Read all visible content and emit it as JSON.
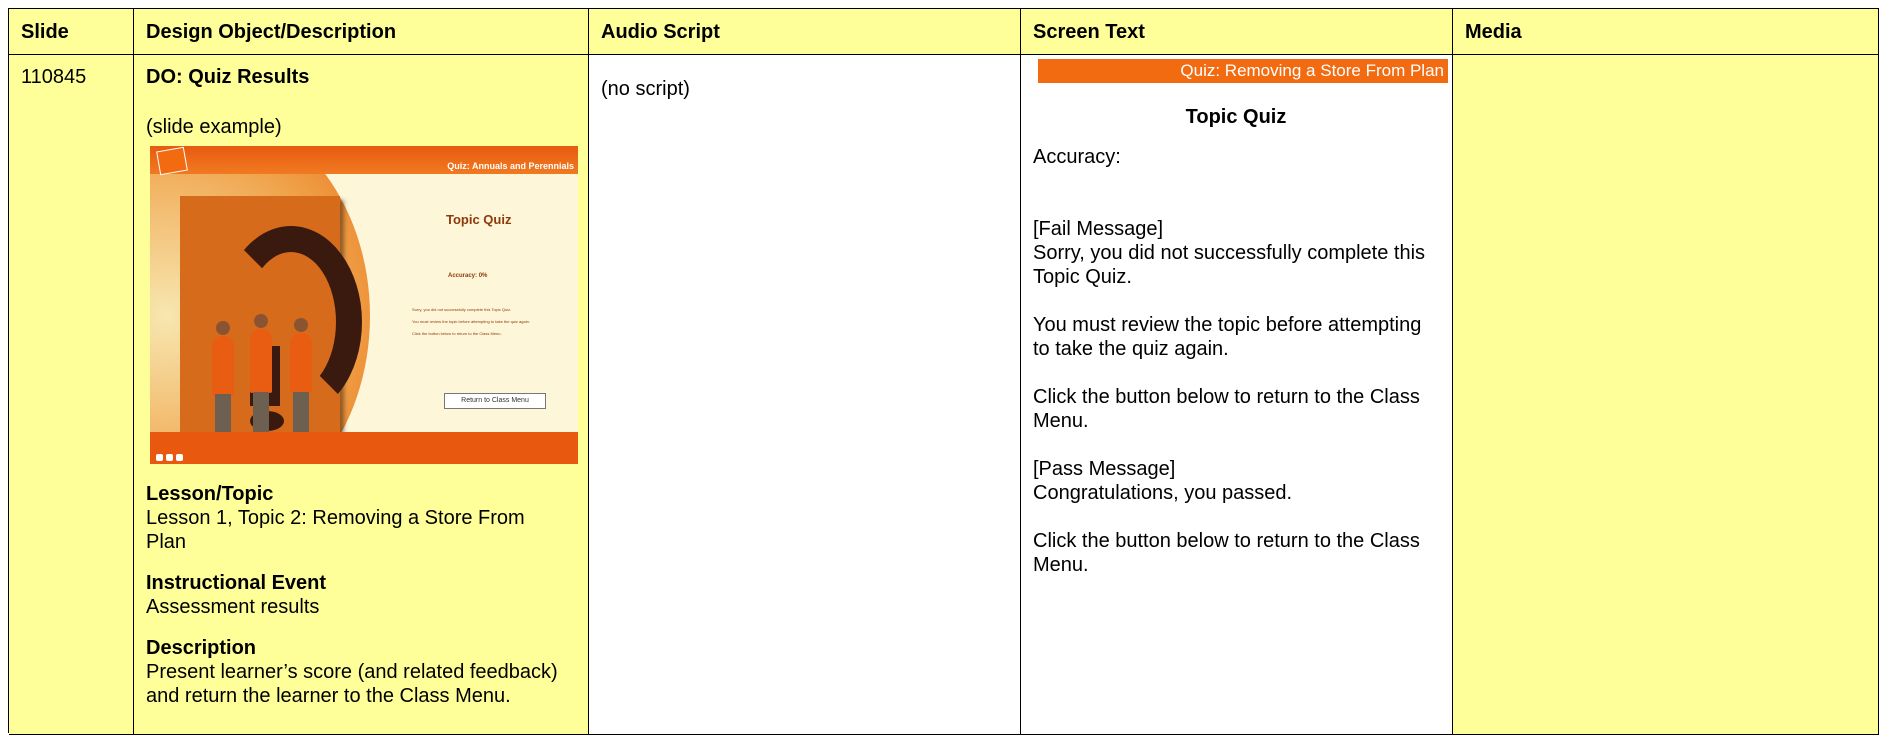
{
  "headers": {
    "slide": "Slide",
    "design": "Design Object/Description",
    "audio": "Audio Script",
    "screen": "Screen Text",
    "media": "Media"
  },
  "row": {
    "slide_number": "110845",
    "design": {
      "do_title": "DO: Quiz Results",
      "slide_example_label": "(slide example)",
      "lesson_heading": "Lesson/Topic",
      "lesson_text": "Lesson 1, Topic 2: Removing a Store From Plan",
      "event_heading": "Instructional Event",
      "event_text": "Assessment results",
      "description_heading": "Description",
      "description_text": "Present learner’s score (and related feedback) and return the learner to the Class Menu."
    },
    "thumbnail": {
      "header_title": "Quiz: Annuals and Perennials",
      "topic_quiz": "Topic Quiz",
      "accuracy": "Accuracy:",
      "accuracy_value": "0%",
      "line1": "Sorry, you did not successfully complete this Topic Quiz.",
      "line2": "You must review the topic before attempting to take the quiz again.",
      "line3": "Click the button below to return to the Class Menu.",
      "button": "Return to Class Menu"
    },
    "audio": "(no script)",
    "screen": {
      "banner": "Quiz: Removing a Store From Plan",
      "topic_quiz": "Topic Quiz",
      "accuracy": "Accuracy:",
      "fail_label": "[Fail Message]",
      "fail_text": "Sorry, you did not successfully complete this Topic Quiz.",
      "review_text": "You must review the topic before attempting to take the quiz again.",
      "click_text_1": "Click the button below to return to the Class Menu.",
      "pass_label": "[Pass Message]",
      "pass_text": "Congratulations, you passed.",
      "click_text_2": "Click the button below to return to the Class Menu."
    },
    "media": ""
  },
  "colors": {
    "cell_yellow": "#ffff99",
    "banner_orange": "#f26b11"
  }
}
